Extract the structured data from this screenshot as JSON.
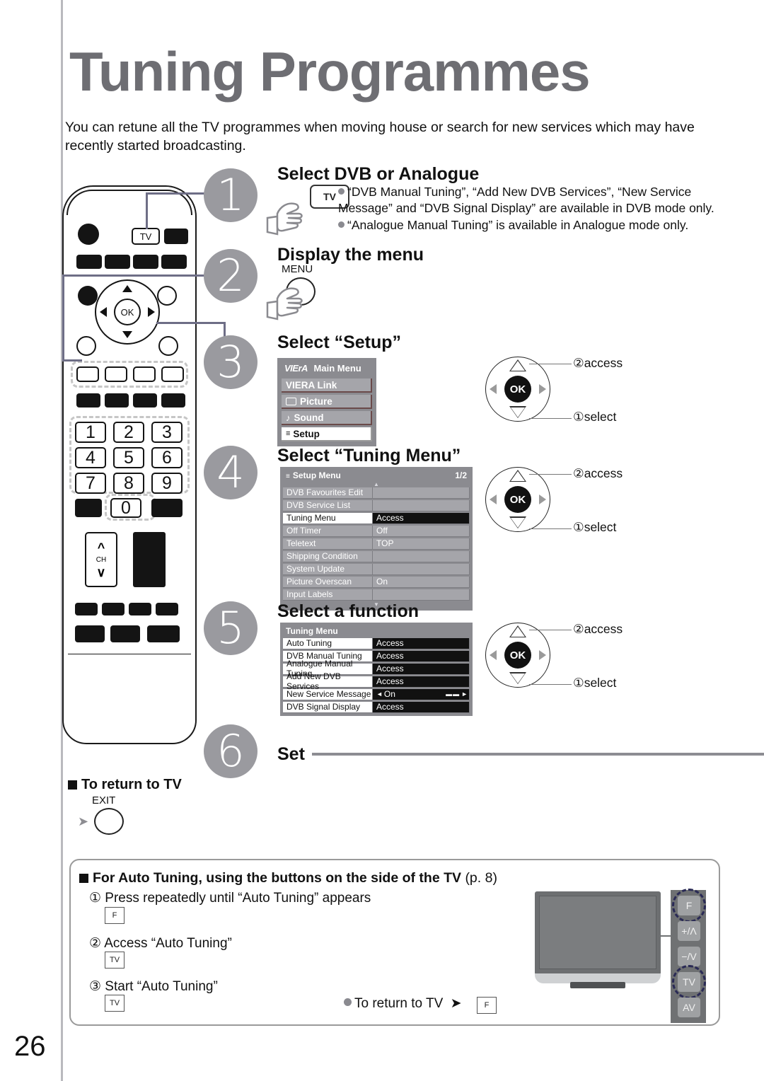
{
  "page": {
    "title": "Tuning Programmes",
    "intro": "You can retune all the TV programmes when moving house or search for new services which may have recently started broadcasting.",
    "number": "26"
  },
  "steps": [
    {
      "num": "1",
      "title": "Select DVB or Analogue"
    },
    {
      "num": "2",
      "title": "Display the menu"
    },
    {
      "num": "3",
      "title": "Select “Setup”"
    },
    {
      "num": "4",
      "title": "Select “Tuning Menu”"
    },
    {
      "num": "5",
      "title": "Select a function"
    },
    {
      "num": "6",
      "title": "Set"
    }
  ],
  "step1": {
    "key_label": "TV",
    "bullet1": "“DVB Manual Tuning”, “Add New DVB Services”, “New Service Message” and “DVB Signal Display” are available in DVB mode only.",
    "bullet2": "“Analogue Manual Tuning” is available in Analogue mode only."
  },
  "step2": {
    "key_label": "MENU"
  },
  "main_menu": {
    "brand": "VIErA",
    "header": "Main Menu",
    "items": [
      {
        "label": "VIERA Link",
        "icon": "none",
        "selected": false
      },
      {
        "label": "Picture",
        "icon": "picture-icon",
        "selected": false
      },
      {
        "label": "Sound",
        "icon": "music-note-icon",
        "selected": false
      },
      {
        "label": "Setup",
        "icon": "list-icon",
        "selected": true
      }
    ]
  },
  "setup_menu": {
    "header": "Setup Menu",
    "page_indicator": "1/2",
    "rows": [
      {
        "label": "DVB Favourites Edit",
        "value": "",
        "selected": false
      },
      {
        "label": "DVB Service List",
        "value": "",
        "selected": false
      },
      {
        "label": "Tuning Menu",
        "value": "Access",
        "selected": true
      },
      {
        "label": "Off Timer",
        "value": "Off",
        "selected": false
      },
      {
        "label": "Teletext",
        "value": "TOP",
        "selected": false
      },
      {
        "label": "Shipping Condition",
        "value": "",
        "selected": false
      },
      {
        "label": "System Update",
        "value": "",
        "selected": false
      },
      {
        "label": "Picture Overscan",
        "value": "On",
        "selected": false
      },
      {
        "label": "Input Labels",
        "value": "",
        "selected": false
      }
    ]
  },
  "tuning_menu": {
    "header": "Tuning Menu",
    "rows": [
      {
        "label": "Auto Tuning",
        "value": "Access",
        "arrows": false
      },
      {
        "label": "DVB Manual Tuning",
        "value": "Access",
        "arrows": false
      },
      {
        "label": "Analogue Manual Tuning",
        "value": "Access",
        "arrows": false
      },
      {
        "label": "Add New DVB Services",
        "value": "Access",
        "arrows": false
      },
      {
        "label": "New Service Message",
        "value": "On",
        "arrows": true
      },
      {
        "label": "DVB Signal Display",
        "value": "Access",
        "arrows": false
      }
    ]
  },
  "pad": {
    "ok_label": "OK",
    "access_label": "②access",
    "select_label": "①select"
  },
  "return_to_tv": {
    "heading": "To return to TV",
    "key_label": "EXIT"
  },
  "bottom": {
    "heading": "For Auto Tuning, using the buttons on the side of the TV",
    "heading_page_ref": "(p. 8)",
    "step1_text": "① Press repeatedly until “Auto Tuning” appears",
    "step1_key": "F",
    "step2_text": "② Access “Auto Tuning”",
    "step2_key": "TV",
    "step3_text": "③ Start “Auto Tuning”",
    "step3_key": "TV",
    "return_text": "To return to TV",
    "return_key": "F"
  },
  "tv_side_buttons": [
    {
      "label": "F",
      "highlighted": true
    },
    {
      "label": "+/Λ",
      "highlighted": false
    },
    {
      "label": "−/V",
      "highlighted": false
    },
    {
      "label": "TV",
      "highlighted": true
    },
    {
      "label": "AV",
      "highlighted": false
    }
  ],
  "remote": {
    "ok_label": "OK",
    "tv_key": "TV",
    "ch_label": "CH",
    "numbers": [
      "1",
      "2",
      "3",
      "4",
      "5",
      "6",
      "7",
      "8",
      "9",
      "0"
    ]
  },
  "colors": {
    "title_gray": "#6e6e73",
    "step_circle": "#9a9a9f",
    "osd_bg": "#8b8b90",
    "osd_row": "#a5a5aa",
    "osd_highlight": "#111111",
    "connector": "#6e6e86"
  }
}
